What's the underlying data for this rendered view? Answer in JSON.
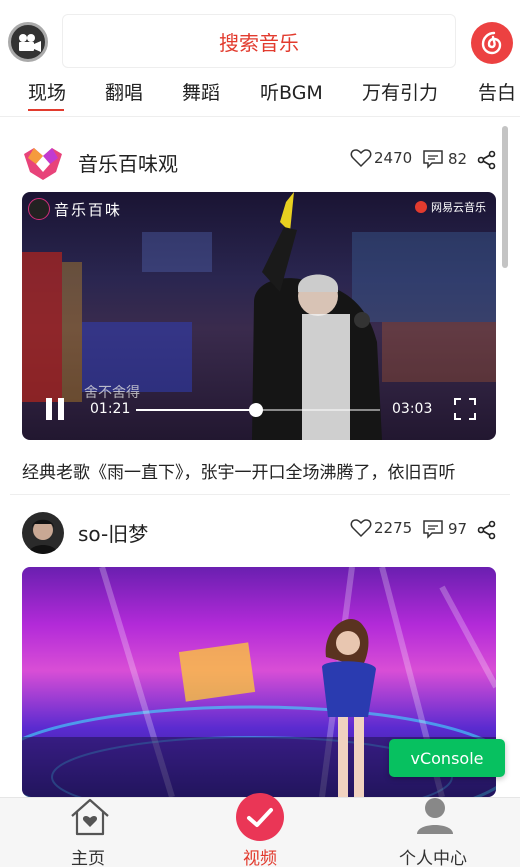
{
  "search": {
    "placeholder": "搜索音乐"
  },
  "tabs": [
    {
      "label": "现场",
      "active": true
    },
    {
      "label": "翻唱"
    },
    {
      "label": "舞蹈"
    },
    {
      "label": "听BGM"
    },
    {
      "label": "万有引力"
    },
    {
      "label": "告白"
    }
  ],
  "feed": [
    {
      "author": "音乐百味观",
      "likes": "2470",
      "comments": "82",
      "watermark_left": "音乐百味",
      "watermark_right": "网易云音乐",
      "subtitle": "舍不舍得",
      "player": {
        "current_time": "01:21",
        "duration": "03:03",
        "progress": 0.49
      },
      "description": "经典老歌《雨一直下》，张宇一开口全场沸腾了，依旧百听"
    },
    {
      "author": "so-旧梦",
      "likes": "2275",
      "comments": "97"
    }
  ],
  "vconsole": {
    "label": "vConsole"
  },
  "bottom_nav": [
    {
      "label": "主页",
      "icon": "home-icon"
    },
    {
      "label": "视频",
      "icon": "check-circle-icon",
      "active": true
    },
    {
      "label": "个人中心",
      "icon": "user-icon"
    }
  ],
  "colors": {
    "accent": "#e23b2e",
    "vconsole": "#07c160",
    "netease_red": "#ec4141"
  }
}
